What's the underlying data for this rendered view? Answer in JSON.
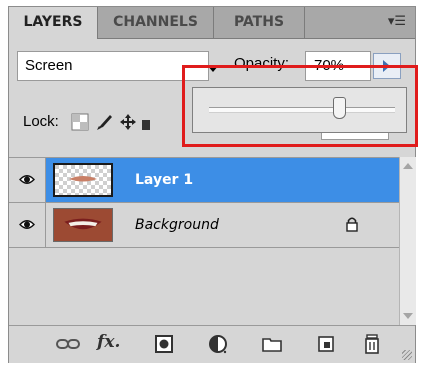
{
  "tabs": [
    {
      "label": "LAYERS",
      "active": true
    },
    {
      "label": "CHANNELS",
      "active": false
    },
    {
      "label": "PATHS",
      "active": false
    }
  ],
  "panel_menu_icon": "panel-menu-icon",
  "blend_mode": {
    "value": "Screen"
  },
  "opacity": {
    "label": "Opacity:",
    "value": "70%",
    "level": 0.7
  },
  "lock": {
    "label": "Lock:",
    "icons": [
      "lock-transparent-icon",
      "lock-image-icon",
      "lock-position-icon"
    ]
  },
  "layers": [
    {
      "name": "Layer 1",
      "selected": true,
      "visible": true,
      "locked": false
    },
    {
      "name": "Background",
      "selected": false,
      "visible": true,
      "locked": true
    }
  ],
  "toolbar": {
    "icons": [
      "link-layers-icon",
      "fx-icon",
      "layer-mask-icon",
      "adjustment-layer-icon",
      "new-group-icon",
      "new-layer-icon",
      "trash-icon"
    ],
    "fx_label": "fx."
  },
  "colors": {
    "selection": "#3d8ee6",
    "highlight_box": "#e01c1c"
  }
}
